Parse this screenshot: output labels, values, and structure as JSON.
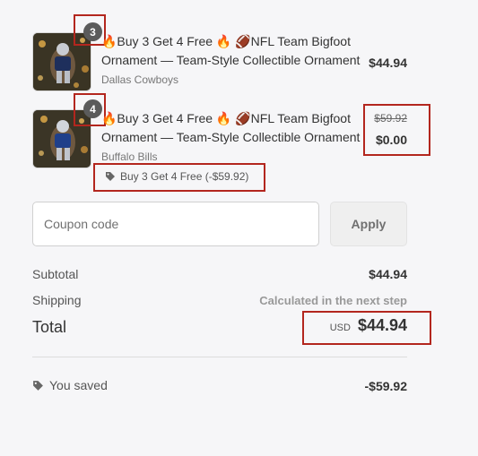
{
  "items": [
    {
      "quantity": "3",
      "title": "🔥Buy 3 Get 4 Free 🔥 🏈NFL Team Bigfoot Ornament — Team-Style Collectible Ornament",
      "variant": "Dallas Cowboys",
      "price": "$44.94"
    },
    {
      "quantity": "4",
      "title": "🔥Buy 3 Get 4 Free 🔥 🏈NFL Team Bigfoot Ornament — Team-Style Collectible Ornament",
      "variant": "Buffalo Bills",
      "original_price": "$59.92",
      "price": "$0.00",
      "discount": "Buy 3 Get 4 Free (-$59.92)"
    }
  ],
  "coupon": {
    "placeholder": "Coupon code",
    "apply_label": "Apply"
  },
  "summary": {
    "subtotal_label": "Subtotal",
    "subtotal_value": "$44.94",
    "shipping_label": "Shipping",
    "shipping_value": "Calculated in the next step",
    "total_label": "Total",
    "currency": "USD",
    "total_value": "$44.94",
    "saved_label": "You saved",
    "saved_value": "-$59.92"
  },
  "icons": {
    "tag": "tag-icon"
  },
  "colors": {
    "highlight": "#b3261e",
    "background": "#f6f6f8"
  }
}
